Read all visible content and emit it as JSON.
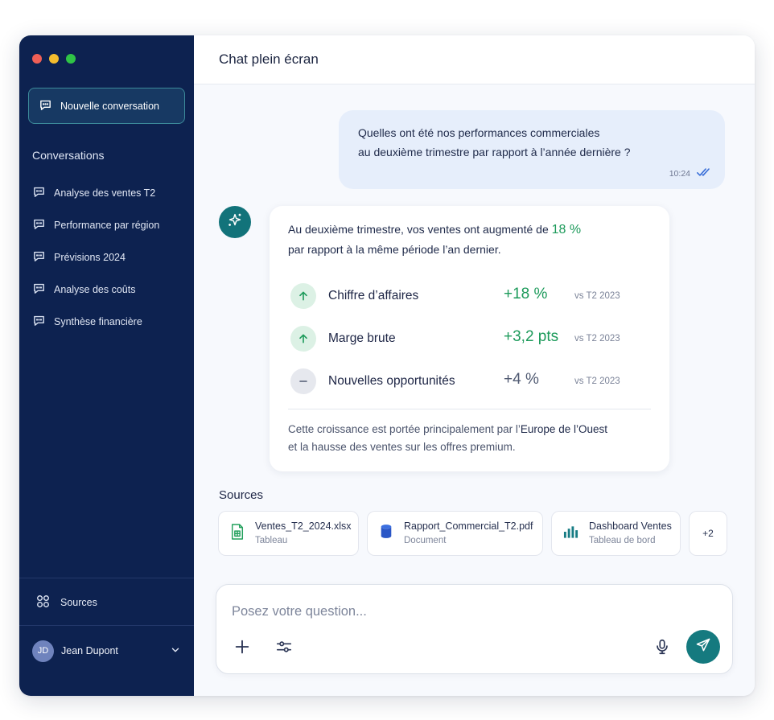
{
  "sidebar": {
    "new_conversation": "Nouvelle conversation",
    "conversations_title": "Conversations",
    "conversations": [
      {
        "label": "Analyse des ventes T2"
      },
      {
        "label": "Performance par région"
      },
      {
        "label": "Prévisions 2024"
      },
      {
        "label": "Analyse des coûts"
      },
      {
        "label": "Synthèse financière"
      }
    ],
    "sources_label": "Sources",
    "user": {
      "initials": "JD",
      "name": "Jean Dupont"
    }
  },
  "header": {
    "title": "Chat plein écran"
  },
  "user_message": {
    "line1": "Quelles ont été nos performances commerciales",
    "line2": "au deuxième trimestre par rapport à l’année dernière ?",
    "time": "10:24"
  },
  "assistant_message": {
    "intro_text": "Au deuxième trimestre, vos ventes ont augmenté de ",
    "intro_highlight": "18 %",
    "intro_line2": "par rapport à la même période l’an dernier.",
    "metrics": [
      {
        "label": "Chiffre d’affaires",
        "value": "+18 %",
        "compare": "vs T2 2023",
        "trend": "up"
      },
      {
        "label": "Marge brute",
        "value": "+3,2 pts",
        "compare": "vs T2 2023",
        "trend": "up"
      },
      {
        "label": "Nouvelles opportunités",
        "value": "+4 %",
        "compare": "vs T2 2023",
        "trend": "flat"
      }
    ],
    "footer_prefix": "Cette croissance est portée principalement par l’",
    "footer_highlight": "Europe de l’Ouest",
    "footer_line2": "et la hausse des ventes sur les offres premium."
  },
  "sources": {
    "title": "Sources",
    "items": [
      {
        "name": "Ventes_T2_2024.xlsx",
        "type": "Tableau",
        "icon": "spreadsheet-icon"
      },
      {
        "name": "Rapport_Commercial_T2.pdf",
        "type": "Document",
        "icon": "database-icon"
      },
      {
        "name": "Dashboard Ventes",
        "type": "Tableau de bord",
        "icon": "bar-chart-icon"
      }
    ],
    "more": "+2"
  },
  "composer": {
    "placeholder": "Posez votre question..."
  },
  "colors": {
    "sidebar": "#0d2250",
    "accent_teal": "#157a7f",
    "positive_green": "#1c9a5a",
    "user_bubble": "#e6eefb"
  }
}
